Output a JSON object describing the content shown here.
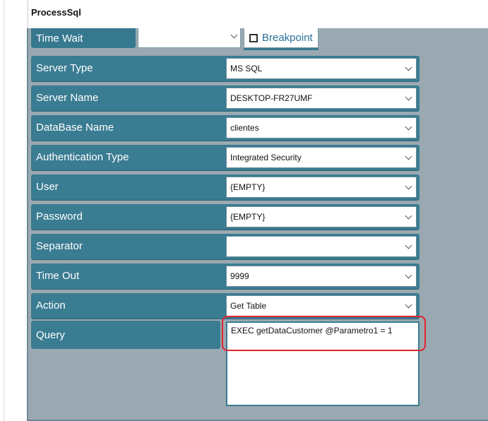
{
  "window": {
    "title": "ProcessSql"
  },
  "time_wait": {
    "label": "Time Wait",
    "value": ""
  },
  "breakpoint": {
    "label": "Breakpoint",
    "checked": false
  },
  "fields": [
    {
      "label": "Server Type",
      "value": "MS SQL"
    },
    {
      "label": "Server Name",
      "value": "DESKTOP-FR27UMF"
    },
    {
      "label": "DataBase Name",
      "value": "clientes"
    },
    {
      "label": "Authentication Type",
      "value": "Integrated Security"
    },
    {
      "label": "User",
      "value": "{EMPTY}"
    },
    {
      "label": "Password",
      "value": "{EMPTY}"
    },
    {
      "label": "Separator",
      "value": ""
    },
    {
      "label": "Time Out",
      "value": "9999"
    },
    {
      "label": "Action",
      "value": "Get Table"
    }
  ],
  "query": {
    "label": "Query",
    "value": "EXEC getDataCustomer @Parametro1 = 1"
  },
  "icons": {
    "dropdown": "chevron-down-icon",
    "checkbox": "checkbox-icon"
  },
  "colors": {
    "label_bg": "#3a7c92",
    "panel_bg": "#9aa9b1",
    "highlight": "#e0232c",
    "link": "#2a6f9a"
  }
}
